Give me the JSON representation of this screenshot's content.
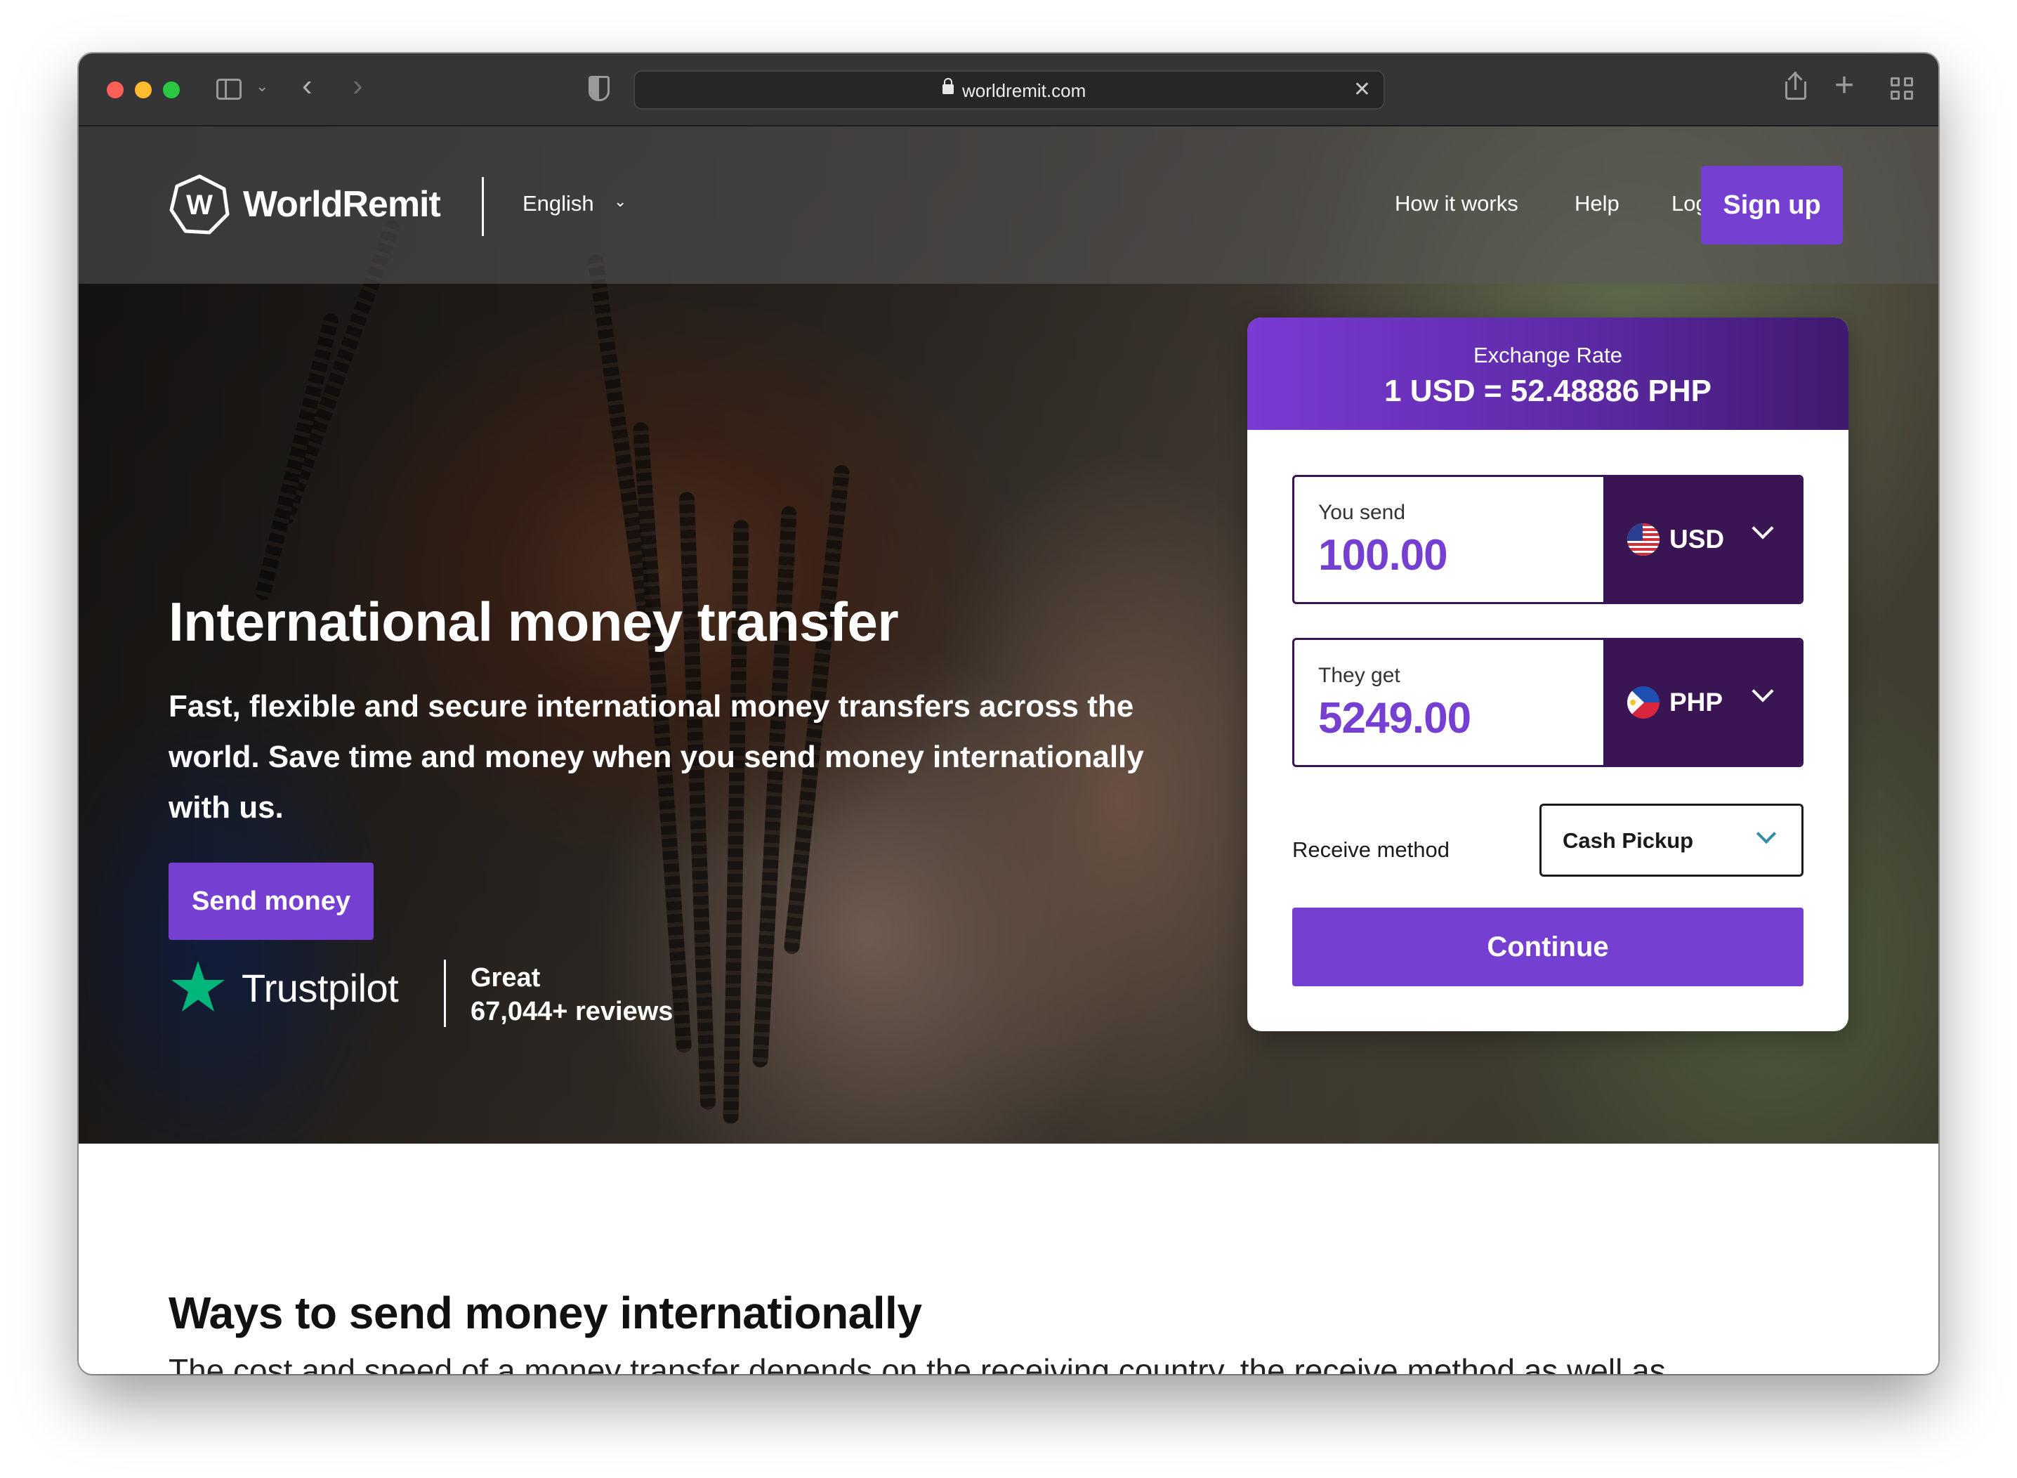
{
  "browser": {
    "url": "worldremit.com"
  },
  "header": {
    "logo_text": "WorldRemit",
    "language": "English",
    "nav": [
      "How it works",
      "Help",
      "Log in"
    ],
    "signup_label": "Sign up"
  },
  "hero": {
    "title": "International money transfer",
    "subtitle": "Fast, flexible and secure international money transfers across the world. Save time and money when you send money internationally with us.",
    "cta_label": "Send money",
    "trustpilot": {
      "name": "Trustpilot",
      "rating_word": "Great",
      "reviews": "67,044+ reviews"
    }
  },
  "calculator": {
    "rate_label": "Exchange Rate",
    "rate_value": "1 USD = 52.48886 PHP",
    "send": {
      "label": "You send",
      "amount": "100.00",
      "currency": "USD"
    },
    "receive": {
      "label": "They get",
      "amount": "5249.00",
      "currency": "PHP"
    },
    "method_label": "Receive method",
    "method_value": "Cash Pickup",
    "continue_label": "Continue"
  },
  "section": {
    "title": "Ways to send money internationally",
    "text": "The cost and speed of a money transfer depends on the receiving country, the receive method as well as"
  },
  "colors": {
    "brand_purple": "#7540d1",
    "dark_purple": "#3a1553",
    "trustpilot_green": "#00b67a"
  }
}
